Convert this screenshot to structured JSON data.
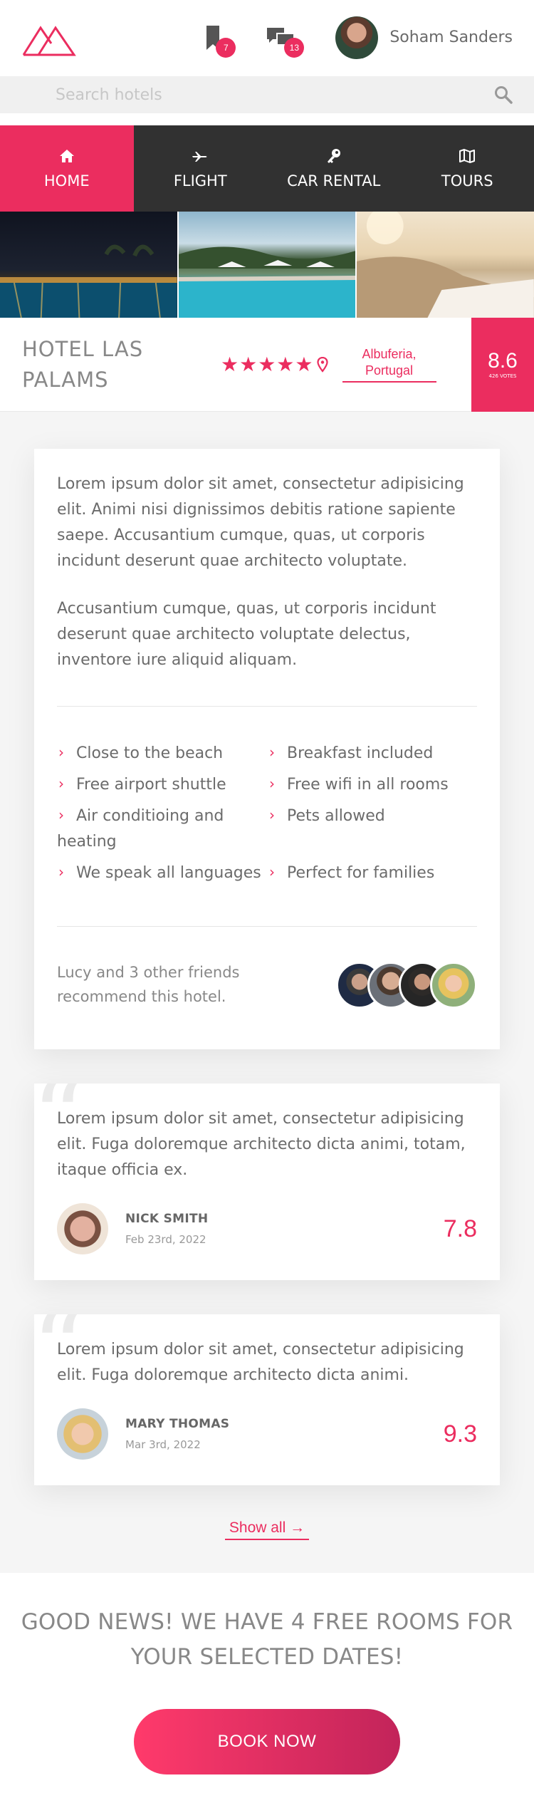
{
  "header": {
    "bookmarks_count": "7",
    "messages_count": "13",
    "user_name": "Soham Sanders",
    "icons": [
      "logo-icon",
      "bookmark-icon",
      "chat-icon",
      "avatar"
    ]
  },
  "search": {
    "placeholder": "Search hotels",
    "value": ""
  },
  "nav": {
    "items": [
      {
        "label": "HOME",
        "icon": "home-icon",
        "active": true
      },
      {
        "label": "FLIGHT",
        "icon": "plane-icon",
        "active": false
      },
      {
        "label": "CAR RENTAL",
        "icon": "key-icon",
        "active": false
      },
      {
        "label": "TOURS",
        "icon": "map-icon",
        "active": false
      }
    ]
  },
  "hotel": {
    "name": "HOTEL LAS PALAMS",
    "stars": "★★★★★",
    "rating": 5,
    "location": "Albuferia, Portugal",
    "score": "8.6",
    "votes": "426 VOTES"
  },
  "description": {
    "paragraphs": [
      "Lorem ipsum dolor sit amet, consectetur adipisicing elit. Animi nisi dignissimos debitis ratione sapiente saepe. Accusantium cumque, quas, ut corporis incidunt deserunt quae architecto voluptate.",
      "Accusantium cumque, quas, ut corporis incidunt deserunt quae architecto voluptate delectus, inventore iure aliquid aliquam."
    ],
    "features": [
      "Close to the beach",
      "Breakfast included",
      "Free airport shuttle",
      "Free wifi in all rooms",
      "Air conditioing and heating",
      "Pets allowed",
      "We speak all languages",
      "Perfect for families"
    ],
    "friends_text": "Lucy and 3 other friends recommend this hotel."
  },
  "reviews": [
    {
      "text": "Lorem ipsum dolor sit amet, consectetur adipisicing elit. Fuga doloremque architecto dicta animi, totam, itaque officia ex.",
      "name": "NICK SMITH",
      "date": "Feb 23rd, 2022",
      "score": "7.8"
    },
    {
      "text": "Lorem ipsum dolor sit amet, consectetur adipisicing elit. Fuga doloremque architecto dicta animi.",
      "name": "MARY THOMAS",
      "date": "Mar 3rd, 2022",
      "score": "9.3"
    }
  ],
  "show_all": "Show all  →",
  "promo": {
    "text": "GOOD NEWS! WE HAVE 4 FREE ROOMS FOR YOUR SELECTED DATES!",
    "button": "BOOK NOW"
  },
  "colors": {
    "accent": "#eb2d5f",
    "nav_bg": "#313131",
    "page_bg": "#f5f5f5"
  }
}
